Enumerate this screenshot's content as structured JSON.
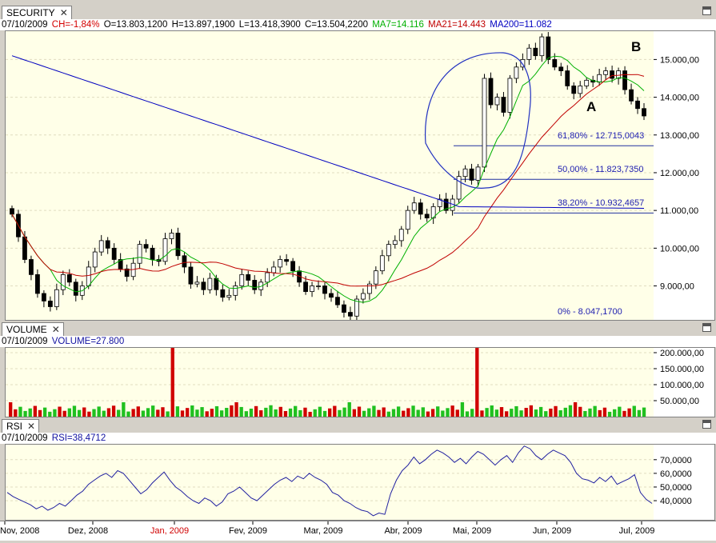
{
  "security_panel": {
    "tab_label": "SECURITY",
    "info": {
      "date": "07/10/2009",
      "ch": "CH=-1,84%",
      "o": "O=13.803,1200",
      "h": "H=13.897,1900",
      "l": "L=13.418,3900",
      "c": "C=13.504,2200",
      "ma7": "MA7=14.116",
      "ma21": "MA21=14.443",
      "ma200": "MA200=11.082"
    },
    "fib_labels": [
      "61,80% - 12.715,0043",
      "50,00% - 11.823,7350",
      "38,20% - 10.932,4657",
      "0% - 8.047,1700"
    ],
    "annotations": [
      "A",
      "B"
    ]
  },
  "volume_panel": {
    "tab_label": "VOLUME",
    "info": {
      "date": "07/10/2009",
      "value": "VOLUME=27.800"
    }
  },
  "rsi_panel": {
    "tab_label": "RSI",
    "info": {
      "date": "07/10/2009",
      "value": "RSI=38,4712"
    }
  },
  "colors": {
    "ch": "#d40000",
    "ma7": "#00b000",
    "ma21": "#c00000",
    "ma200": "#0000c0",
    "vol_up": "#20c020",
    "vol_down": "#d00000",
    "rsi": "#2020a0",
    "plot_bg": "#ffffe8"
  },
  "chart_data": [
    {
      "type": "candlestick",
      "title": "SECURITY",
      "x_ticks": [
        "Nov, 2008",
        "Dez, 2008",
        "Jan, 2009",
        "Fev, 2009",
        "Mar, 2009",
        "Abr, 2009",
        "Mai, 2009",
        "Jun, 2009",
        "Jul, 2009"
      ],
      "x_tick_highlight": "Jan, 2009",
      "y_ticks": [
        "9.000,00",
        "10.000,00",
        "11.000,00",
        "12.000,00",
        "13.000,00",
        "14.000,00",
        "15.000,00"
      ],
      "ylim": [
        8100,
        15750
      ],
      "close": [
        10900,
        10300,
        9700,
        9300,
        8800,
        8600,
        8450,
        8900,
        9300,
        9100,
        8750,
        9000,
        9500,
        9900,
        10200,
        10000,
        9700,
        9450,
        9250,
        9600,
        10100,
        10000,
        9700,
        9650,
        10250,
        10400,
        9800,
        9500,
        9050,
        9100,
        8900,
        9200,
        8900,
        8700,
        8750,
        9000,
        9300,
        9150,
        8900,
        9100,
        9350,
        9500,
        9700,
        9650,
        9400,
        9100,
        8850,
        9000,
        9000,
        8800,
        8700,
        8500,
        8300,
        8200,
        8650,
        8800,
        9050,
        9400,
        9800,
        10100,
        10200,
        10500,
        11000,
        11200,
        10900,
        10800,
        11100,
        11300,
        11000,
        11300,
        11900,
        12100,
        11800,
        12150,
        14500,
        13800,
        14000,
        13600,
        14500,
        14800,
        15000,
        15300,
        15100,
        15600,
        15000,
        14800,
        14700,
        14300,
        14100,
        14300,
        14450,
        14400,
        14600,
        14700,
        14500,
        14700,
        14200,
        13900,
        13700,
        13504
      ],
      "series": [
        {
          "name": "MA7"
        },
        {
          "name": "MA21"
        },
        {
          "name": "MA200"
        }
      ],
      "fibonacci": [
        {
          "level": "61,80%",
          "value": 12715.0043
        },
        {
          "level": "50,00%",
          "value": 11823.735
        },
        {
          "level": "38,20%",
          "value": 10932.4657
        },
        {
          "level": "0%",
          "value": 8047.17
        }
      ]
    },
    {
      "type": "bar",
      "title": "VOLUME",
      "y_ticks": [
        "50.000,00",
        "100.000,00",
        "150.000,00",
        "200.000,00"
      ],
      "ylim": [
        0,
        215000
      ],
      "spikes": [
        {
          "index": 33,
          "value": 220000
        },
        {
          "index": 95,
          "value": 220000
        }
      ]
    },
    {
      "type": "line",
      "title": "RSI",
      "y_ticks": [
        "40,0000",
        "50,0000",
        "60,0000",
        "70,0000"
      ],
      "ylim": [
        26,
        81
      ],
      "values": [
        46,
        43,
        41,
        39,
        37,
        34,
        36,
        33,
        35,
        38,
        36,
        40,
        44,
        47,
        52,
        55,
        58,
        60,
        57,
        62,
        60,
        55,
        50,
        45,
        48,
        53,
        57,
        61,
        55,
        50,
        47,
        43,
        40,
        38,
        42,
        40,
        36,
        39,
        45,
        47,
        50,
        46,
        42,
        40,
        44,
        48,
        52,
        55,
        57,
        54,
        58,
        56,
        60,
        57,
        55,
        52,
        46,
        44,
        40,
        38,
        35,
        33,
        32,
        29,
        31,
        30,
        45,
        55,
        62,
        66,
        72,
        67,
        70,
        74,
        77,
        75,
        72,
        68,
        71,
        67,
        72,
        76,
        74,
        70,
        66,
        70,
        73,
        68,
        75,
        80,
        78,
        73,
        70,
        74,
        77,
        75,
        73,
        68,
        60,
        56,
        55,
        53,
        57,
        54,
        58,
        52,
        54,
        56,
        59,
        46,
        41,
        38
      ]
    }
  ]
}
